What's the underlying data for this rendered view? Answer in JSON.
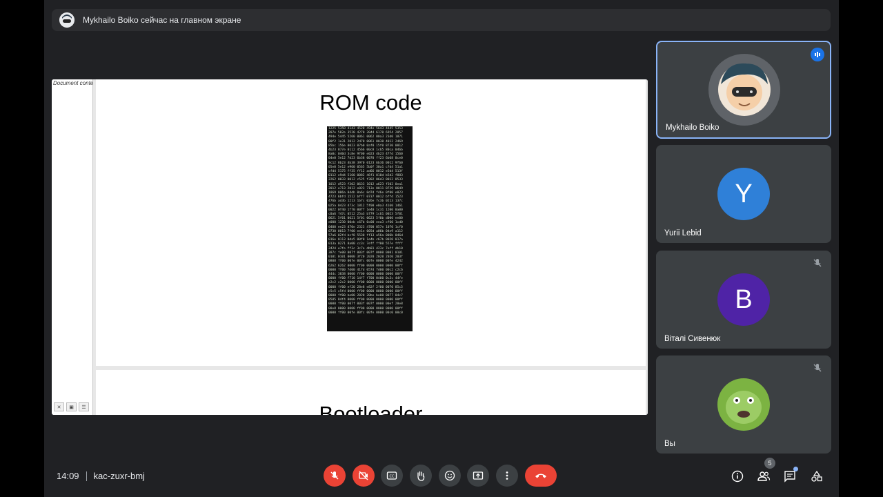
{
  "banner": {
    "text": "Mykhailo Boiko сейчас на главном экране"
  },
  "presentation": {
    "outline_label": "Document conte",
    "slides": [
      {
        "title": "ROM code"
      },
      {
        "title": "Bootloader"
      }
    ],
    "hexdump": "1225 535B 4143 4520 494e 5643 4445 5353\n207e 582e 3520 4270 2044 6170 6954 2057\n494e 5445 5260 0061 0062 00a3 23d0 1871\n00f2 1e31 2012 2d70 0061 0030 4012 2469\n85bc 156e 0023 07b0 0af0 15f0 8730 0012\n4b23 877e 0112 4566 00c8 1c65 80ca 046b\n8a0c 040d 3c8e 9f00 e023 4b23 47fd 1560\n04e0 5e12 7d23 6b38 0070 ff23 6b68 0ce0\n9c12 8b23 4b38 3970 0123 6b36 0012 9f60\n05e0 5e12 e960 0565 5b0f 30a1 cfd4 51a1\ncfd4 5175 ff35 ff12 ad66 0012 e5d4 513f\n0112 e9d4 5160 0082 46f1 010d b5d2 f883\n2262 0033 0012 c525 f302 06d3 0012 8533\n1012 d523 f302 0633 1012 a623 f302 0ea1\n2012 e713 2012 e023 713e 0011 0729 0649\n1869 006a 04db 0a6c 0d7d f46e 0f00 e023\n4723 6bfd 1512 bff7 0737 0012 bffd 1523\n476b ad3b 1213 1b7c 026e 7c3b 0213 137c\n025a 0423 473c 1812 5f00 e0a3 4160 1461\n0022 0f40 1f70 00ff 1e40 1c31 1200 0a00\nc0a6 f47c 0512 25a3 b779 1c61 0023 5f01\n0621 5f01 0621 5f01 0623 5f0b d000 ee00\ne000 1230 00eb c67b 0c00 eea3 cf60 1cd0\n0400 ee23 470e 2323 4700 057e 1070 1cf0\n0730 0013 7f00 ee1e 005d a06b 04e9 a112\n57a6 02fd bcf8 5530 ff13 a56a 006b 046d\n016e 0113 0da5 00f0 1e4b c67b 0020 017a\n013a 0271 8a00 cc3c 7eff ff00 557e ffff\n2424 e7fe ff3c 3c7e db81 423c 7eff db10\n387c fe00 007f 003f 007f 0000 0001 0101\n0101 0101 0000 3f20 2020 2020 2020 203f\n0808 ff00 00fe 00fc 00fe 0000 007e 4242\n6262 6262 0000 ff00 0000 0000 0000 00ff\n0000 ff00 7d00 417d 057d 7d00 00c2 c2c6\n444c 3838 0000 ff00 0000 0000 0000 00ff\n0000 ff00 f710 14f7 f700 0400 0c3c 44fe\nc2c2 c2c2 0000 ff00 0000 0000 0000 00ff\n0000 ff00 ef20 28e8 e82f 2f00 0070 85c5\nc5c5 c5fd 0000 ff00 0000 0000 0000 00ff\n0000 ff00 be00 2020 20be be00 0077 04c7\n8585 84f4 0000 ff00 0000 0000 0000 00ff\n0000 ff00 007f 003f 007f 0000 00ef 28e8\n08e8 0000 0000 ff00 0000 0000 0000 00ff\n0000 ff00 00fe 00fc 00fe 0000 00c0 00c0"
  },
  "participants": [
    {
      "name": "Mykhailo Boiko",
      "initial": "",
      "avatar_color": "#5f6368",
      "status": "speaking"
    },
    {
      "name": "Yurii Lebid",
      "initial": "Y",
      "avatar_color": "#2f80d8",
      "status": ""
    },
    {
      "name": "Віталі Сивенюк",
      "initial": "B",
      "avatar_color": "#4f23a6",
      "status": "muted"
    },
    {
      "name": "Вы",
      "initial": "",
      "avatar_color": "#6a9c2a",
      "status": "muted"
    }
  ],
  "meeting": {
    "time": "14:09",
    "code": "kac-zuxr-bmj",
    "people_count": "5"
  },
  "colors": {
    "accent": "#8ab4f8",
    "danger": "#ea4335",
    "tile": "#3c4043",
    "background": "#202124"
  }
}
